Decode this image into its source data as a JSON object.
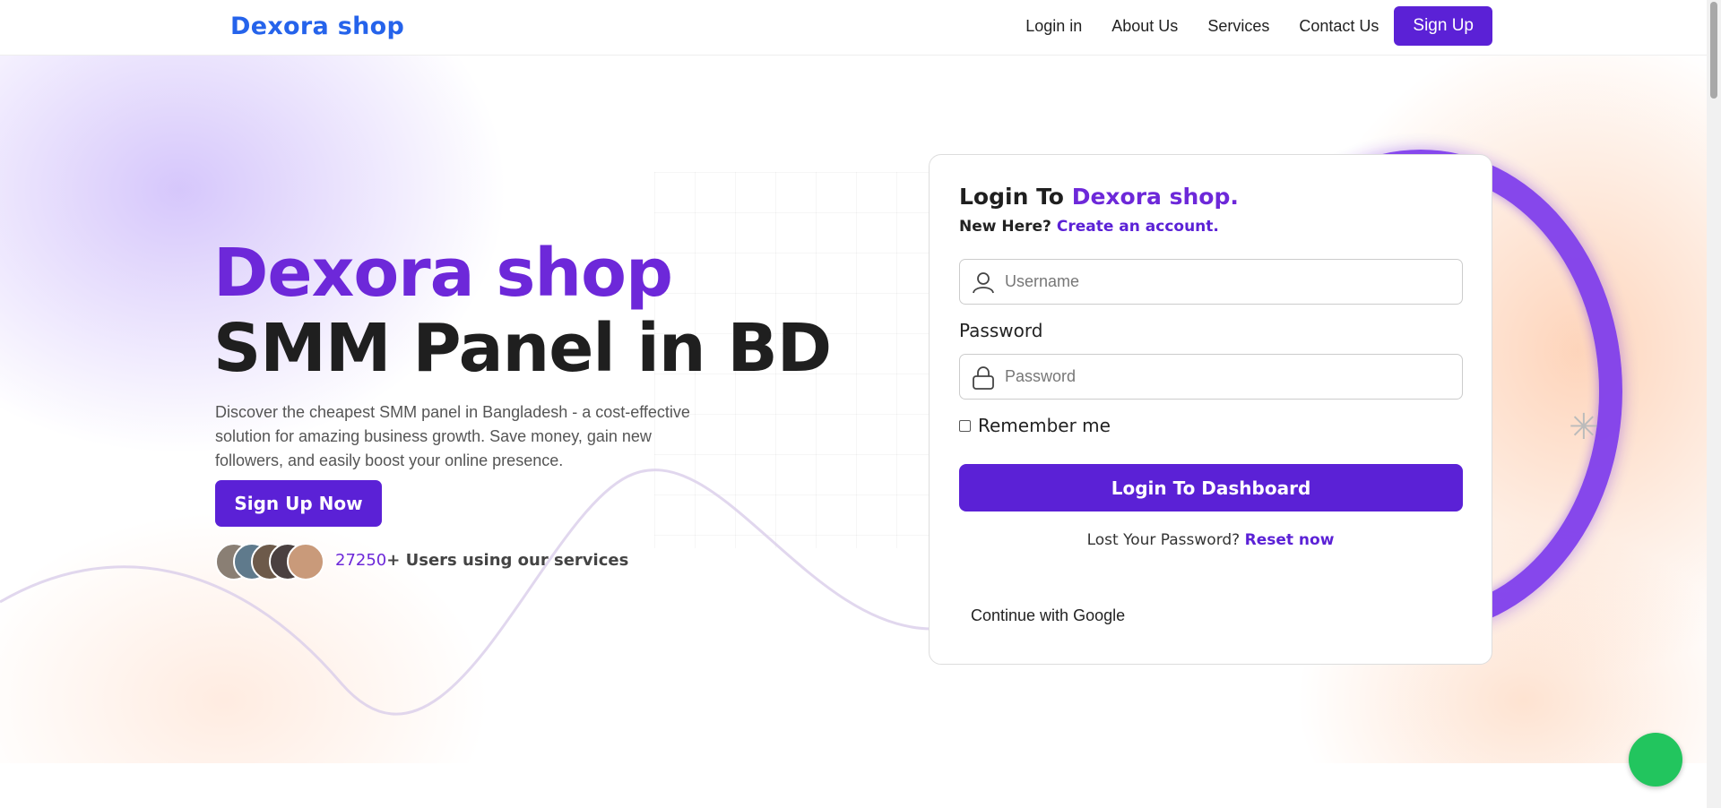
{
  "header": {
    "brand": "Dexora shop",
    "nav": [
      "Login in",
      "About Us",
      "Services",
      "Contact Us"
    ],
    "signup_label": "Sign Up"
  },
  "hero": {
    "title_line1": "Dexora shop",
    "title_line2": "SMM Panel in BD",
    "description": "Discover the cheapest SMM panel in Bangladesh - a cost-effective solution for amazing business growth. Save money, gain new followers, and easily boost your online presence.",
    "cta_label": "Sign Up Now",
    "users_count": "27250",
    "users_text": "+ Users using our services"
  },
  "login": {
    "title_prefix": "Login To ",
    "title_brand": "Dexora shop.",
    "new_here": "New Here? ",
    "create_link": "Create an account.",
    "username_placeholder": "Username",
    "password_label": "Password",
    "password_placeholder": "Password",
    "remember_label": "Remember me",
    "login_button": "Login To Dashboard",
    "lost_text": "Lost Your Password? ",
    "reset_link": "Reset now",
    "google_label": "Continue with Google"
  },
  "colors": {
    "brand_blue": "#2563eb",
    "accent_purple": "#5b21d6",
    "fab_green": "#22c55e"
  },
  "icons": {
    "username": "user-icon",
    "password": "lock-icon",
    "chat": "chat-fab-icon"
  }
}
